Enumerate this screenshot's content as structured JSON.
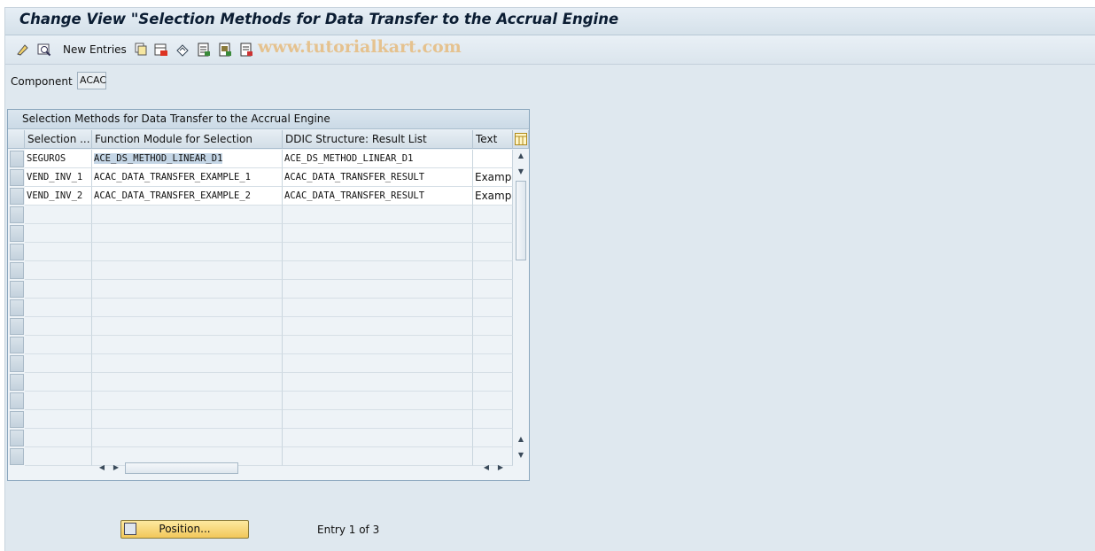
{
  "window": {
    "title": "Change View \"Selection Methods for Data Transfer to the Accrual Engine",
    "watermark": "www.tutorialkart.com"
  },
  "toolbar": {
    "new_entries_label": "New Entries",
    "icons": [
      "display-change-icon",
      "details-icon",
      "copy-icon",
      "delete-icon",
      "undo-icon",
      "select-all-icon",
      "select-block-icon",
      "deselect-all-icon"
    ]
  },
  "filter": {
    "component_label": "Component",
    "component_value": "ACAC"
  },
  "table": {
    "title": "Selection Methods for Data Transfer to the Accrual Engine",
    "columns": [
      "Selection ...",
      "Function Module for Selection",
      "DDIC Structure: Result List",
      "Text"
    ],
    "rows": [
      [
        "SEGUROS",
        "ACE_DS_METHOD_LINEAR_D1",
        "ACE_DS_METHOD_LINEAR_D1",
        ""
      ],
      [
        "VEND_INV_1",
        "ACAC_DATA_TRANSFER_EXAMPLE_1",
        "ACAC_DATA_TRANSFER_RESULT",
        "Example"
      ],
      [
        "VEND_INV_2",
        "ACAC_DATA_TRANSFER_EXAMPLE_2",
        "ACAC_DATA_TRANSFER_RESULT",
        "Example"
      ]
    ]
  },
  "footer": {
    "position_button": "Position...",
    "entry_text": "Entry 1 of 3"
  }
}
